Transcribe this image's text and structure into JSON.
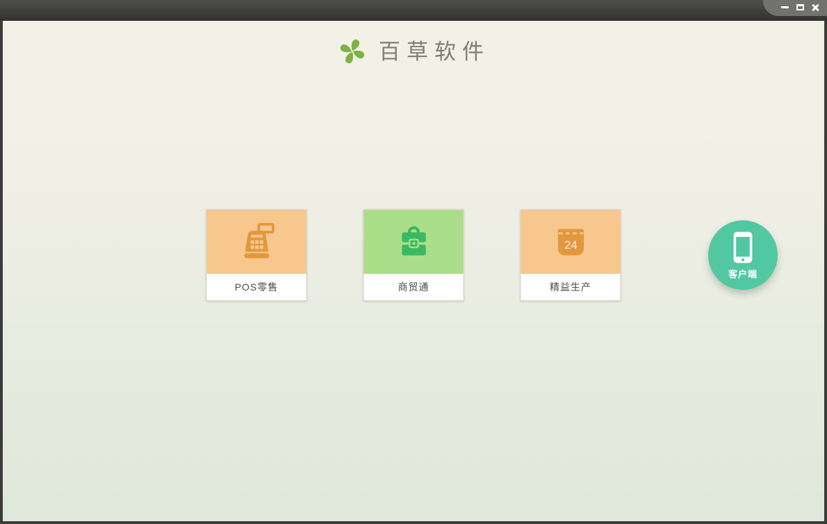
{
  "window": {
    "controls": [
      {
        "name": "minimize-icon"
      },
      {
        "name": "maximize-icon"
      },
      {
        "name": "close-icon"
      }
    ]
  },
  "header": {
    "app_name": "百草软件",
    "logo_icon": "pinwheel-icon"
  },
  "products": [
    {
      "label": "POS零售",
      "icon": "cash-register-icon",
      "theme": "orange"
    },
    {
      "label": "商贸通",
      "icon": "briefcase-icon",
      "theme": "green"
    },
    {
      "label": "精益生产",
      "icon": "calendar-icon",
      "theme": "orange",
      "calendar_day": "24"
    }
  ],
  "client": {
    "label": "客户端",
    "icon": "smartphone-icon"
  },
  "colors": {
    "titlebar-top": "#4d4d4b",
    "titlebar-bottom": "#333331",
    "controls-panel": "#72726f",
    "frame": "#3b3b39",
    "bg-top": "#f2f0e7",
    "bg-bottom": "#dfe8da",
    "card-orange": "#f7c78d",
    "card-orange-icon": "#e3973c",
    "card-green": "#abde88",
    "card-green-icon": "#3bb863",
    "label-bg": "#ffffff",
    "label-text": "#4a4a4a",
    "logo-text": "#7e7e76",
    "client-teal": "#52c8a2",
    "logo-green": "#7cb342",
    "logo-orange": "#f29b38",
    "logo-blue": "#64b5e8",
    "logo-red": "#e2574c"
  }
}
